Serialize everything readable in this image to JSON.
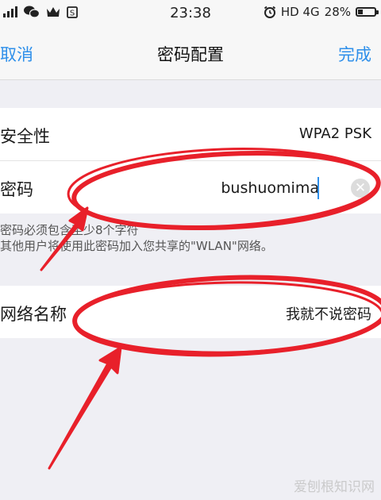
{
  "status_bar": {
    "time": "23:38",
    "network": "HD 4G",
    "battery": "28%",
    "battery_level": 0.28
  },
  "nav": {
    "cancel_label": "取消",
    "title": "密码配置",
    "done_label": "完成"
  },
  "security": {
    "label": "安全性",
    "value": "WPA2 PSK"
  },
  "password": {
    "label": "密码",
    "value": "bushuomima"
  },
  "hint": {
    "line1": "密码必须包含至少8个字符",
    "line2": "其他用户将使用此密码加入您共享的\"WLAN\"网络。"
  },
  "network_name": {
    "label": "网络名称",
    "value": "我就不说密码"
  },
  "watermark": "爱刨根知识网",
  "colors": {
    "accent": "#2e8fea",
    "annotation": "#e8202a",
    "background": "#efeff4"
  }
}
